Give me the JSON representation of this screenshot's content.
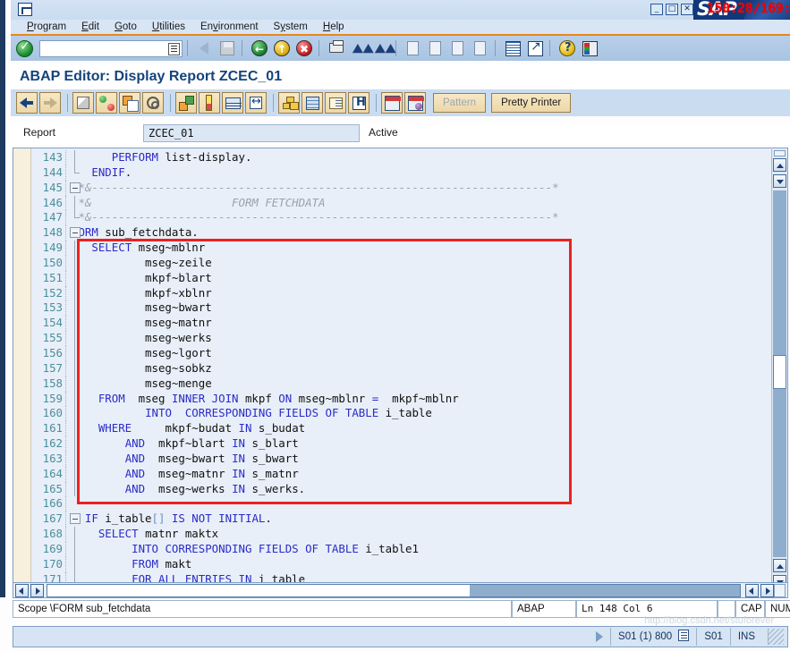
{
  "window": {
    "system_icon": "window-menu-icon",
    "minimize_label": "_",
    "maximize_label": "□",
    "close_label": "✕",
    "brand": "SAP",
    "timer_overlay": "150:28/169:"
  },
  "menubar": {
    "items": [
      {
        "label": "Program"
      },
      {
        "label": "Edit"
      },
      {
        "label": "Goto"
      },
      {
        "label": "Utilities"
      },
      {
        "label": "Environment"
      },
      {
        "label": "System"
      },
      {
        "label": "Help"
      }
    ]
  },
  "main_toolbar": {
    "ok_button": "enter-ok-icon",
    "command_field_value": "",
    "command_field_placeholder": "",
    "icons": [
      "back-arrow-icon",
      "save-icon",
      "back-green-icon",
      "exit-yellow-icon",
      "cancel-red-icon",
      "print-icon",
      "find-icon",
      "find-next-icon",
      "first-page-icon",
      "previous-page-icon",
      "next-page-icon",
      "last-page-icon",
      "new-session-icon",
      "create-shortcut-icon",
      "help-icon",
      "layout-menu-icon"
    ]
  },
  "screen": {
    "title": "ABAP Editor: Display Report ZCEC_01"
  },
  "app_toolbar": {
    "icons": [
      "back-display-icon",
      "forward-display-icon",
      "display-change-icon",
      "check-syntax-icon",
      "copy-object-icon",
      "activate-spiral-icon",
      "object-navigator-icon",
      "check-icon",
      "activate-icon",
      "where-used-icon",
      "structure-tree-icon",
      "stack-icon",
      "list-icon",
      "info-icon",
      "debug-icon",
      "debug-user-icon"
    ],
    "pattern_label": "Pattern",
    "pattern_enabled": false,
    "pretty_printer_label": "Pretty Printer",
    "pretty_printer_enabled": true
  },
  "report_row": {
    "label": "Report",
    "value": "ZCEC_01",
    "status": "Active"
  },
  "code": {
    "first_line_number": 143,
    "lines": [
      {
        "num": "143",
        "fold": "vline",
        "tokens": [
          {
            "t": "      ",
            "c": "id"
          },
          {
            "t": "PERFORM",
            "c": "kw"
          },
          {
            "t": " ",
            "c": "id"
          },
          {
            "t": "list-display",
            "c": "id"
          },
          {
            "t": ".",
            "c": "id"
          }
        ]
      },
      {
        "num": "144",
        "fold": "corner",
        "tokens": [
          {
            "t": "   ",
            "c": "id"
          },
          {
            "t": "ENDIF",
            "c": "kw"
          },
          {
            "t": ".",
            "c": "id"
          }
        ]
      },
      {
        "num": "145",
        "fold": "box",
        "tokens": [
          {
            "t": " *&---------------------------------------------------------------------*",
            "c": "cmt"
          }
        ]
      },
      {
        "num": "146",
        "fold": "vline",
        "tokens": [
          {
            "t": " *&                     FORM FETCHDATA",
            "c": "cmt"
          }
        ]
      },
      {
        "num": "147",
        "fold": "corner",
        "tokens": [
          {
            "t": " *&---------------------------------------------------------------------*",
            "c": "cmt"
          }
        ]
      },
      {
        "num": "148",
        "fold": "box",
        "tokens": [
          {
            "t": "FORM",
            "c": "kw"
          },
          {
            "t": " sub_fetchdata.",
            "c": "id"
          }
        ]
      },
      {
        "num": "149",
        "fold": "vline",
        "tokens": [
          {
            "t": "   ",
            "c": "id"
          },
          {
            "t": "SELECT",
            "c": "kw"
          },
          {
            "t": " mseg~mblnr",
            "c": "id"
          }
        ]
      },
      {
        "num": "150",
        "fold": "vline",
        "tokens": [
          {
            "t": "           mseg~zeile",
            "c": "id"
          }
        ]
      },
      {
        "num": "151",
        "fold": "vline",
        "tokens": [
          {
            "t": "           mkpf~blart",
            "c": "id"
          }
        ]
      },
      {
        "num": "152",
        "fold": "vline",
        "tokens": [
          {
            "t": "           mkpf~xblnr",
            "c": "id"
          }
        ]
      },
      {
        "num": "153",
        "fold": "vline",
        "tokens": [
          {
            "t": "           mseg~bwart",
            "c": "id"
          }
        ]
      },
      {
        "num": "154",
        "fold": "vline",
        "tokens": [
          {
            "t": "           mseg~matnr",
            "c": "id"
          }
        ]
      },
      {
        "num": "155",
        "fold": "vline",
        "tokens": [
          {
            "t": "           mseg~werks",
            "c": "id"
          }
        ]
      },
      {
        "num": "156",
        "fold": "vline",
        "tokens": [
          {
            "t": "           mseg~lgort",
            "c": "id"
          }
        ]
      },
      {
        "num": "157",
        "fold": "vline",
        "tokens": [
          {
            "t": "           mseg~sobkz",
            "c": "id"
          }
        ]
      },
      {
        "num": "158",
        "fold": "vline",
        "tokens": [
          {
            "t": "           mseg~menge",
            "c": "id"
          }
        ]
      },
      {
        "num": "159",
        "fold": "vline",
        "tokens": [
          {
            "t": "    ",
            "c": "id"
          },
          {
            "t": "FROM",
            "c": "kw"
          },
          {
            "t": "  mseg ",
            "c": "id"
          },
          {
            "t": "INNER JOIN",
            "c": "kw"
          },
          {
            "t": " mkpf ",
            "c": "id"
          },
          {
            "t": "ON",
            "c": "kw"
          },
          {
            "t": " mseg~mblnr ",
            "c": "id"
          },
          {
            "t": "=",
            "c": "kw"
          },
          {
            "t": "  mkpf~mblnr",
            "c": "id"
          }
        ]
      },
      {
        "num": "160",
        "fold": "vline",
        "tokens": [
          {
            "t": "           ",
            "c": "id"
          },
          {
            "t": "INTO",
            "c": "kw"
          },
          {
            "t": "  ",
            "c": "id"
          },
          {
            "t": "CORRESPONDING FIELDS OF TABLE",
            "c": "kw"
          },
          {
            "t": " i_table",
            "c": "id"
          }
        ]
      },
      {
        "num": "161",
        "fold": "vline",
        "tokens": [
          {
            "t": "    ",
            "c": "id"
          },
          {
            "t": "WHERE",
            "c": "kw"
          },
          {
            "t": "     mkpf~budat ",
            "c": "id"
          },
          {
            "t": "IN",
            "c": "kw"
          },
          {
            "t": " s_budat",
            "c": "id"
          }
        ]
      },
      {
        "num": "162",
        "fold": "vline",
        "tokens": [
          {
            "t": "        ",
            "c": "id"
          },
          {
            "t": "AND",
            "c": "kw"
          },
          {
            "t": "  mkpf~blart ",
            "c": "id"
          },
          {
            "t": "IN",
            "c": "kw"
          },
          {
            "t": " s_blart",
            "c": "id"
          }
        ]
      },
      {
        "num": "163",
        "fold": "vline",
        "tokens": [
          {
            "t": "        ",
            "c": "id"
          },
          {
            "t": "AND",
            "c": "kw"
          },
          {
            "t": "  mseg~bwart ",
            "c": "id"
          },
          {
            "t": "IN",
            "c": "kw"
          },
          {
            "t": " s_bwart",
            "c": "id"
          }
        ]
      },
      {
        "num": "164",
        "fold": "vline",
        "tokens": [
          {
            "t": "        ",
            "c": "id"
          },
          {
            "t": "AND",
            "c": "kw"
          },
          {
            "t": "  mseg~matnr ",
            "c": "id"
          },
          {
            "t": "IN",
            "c": "kw"
          },
          {
            "t": " s_matnr",
            "c": "id"
          }
        ]
      },
      {
        "num": "165",
        "fold": "vline",
        "tokens": [
          {
            "t": "        ",
            "c": "id"
          },
          {
            "t": "AND",
            "c": "kw"
          },
          {
            "t": "  mseg~werks ",
            "c": "id"
          },
          {
            "t": "IN",
            "c": "kw"
          },
          {
            "t": " s_werks.",
            "c": "id"
          }
        ]
      },
      {
        "num": "166",
        "fold": "none",
        "tokens": [
          {
            "t": "",
            "c": "id"
          }
        ]
      },
      {
        "num": "167",
        "fold": "box",
        "tokens": [
          {
            "t": "  ",
            "c": "id"
          },
          {
            "t": "IF",
            "c": "kw"
          },
          {
            "t": " i_table",
            "c": "id"
          },
          {
            "t": "[]",
            "c": "br"
          },
          {
            "t": " ",
            "c": "id"
          },
          {
            "t": "IS NOT INITIAL",
            "c": "kw"
          },
          {
            "t": ".",
            "c": "id"
          }
        ]
      },
      {
        "num": "168",
        "fold": "vline",
        "tokens": [
          {
            "t": "    ",
            "c": "id"
          },
          {
            "t": "SELECT",
            "c": "kw"
          },
          {
            "t": " matnr maktx",
            "c": "id"
          }
        ]
      },
      {
        "num": "169",
        "fold": "vline",
        "tokens": [
          {
            "t": "         ",
            "c": "id"
          },
          {
            "t": "INTO CORRESPONDING FIELDS OF TABLE",
            "c": "kw"
          },
          {
            "t": " i_table1",
            "c": "id"
          }
        ]
      },
      {
        "num": "170",
        "fold": "vline",
        "tokens": [
          {
            "t": "         ",
            "c": "id"
          },
          {
            "t": "FROM",
            "c": "kw"
          },
          {
            "t": " makt",
            "c": "id"
          }
        ]
      },
      {
        "num": "171",
        "fold": "vline",
        "tokens": [
          {
            "t": "         ",
            "c": "id"
          },
          {
            "t": "FOR ALL ENTRIES IN",
            "c": "kw"
          },
          {
            "t": " i_table",
            "c": "id"
          }
        ]
      }
    ],
    "annotation": {
      "type": "red-rectangle",
      "color": "#ee2020"
    }
  },
  "editor_status": {
    "scope": "Scope \\FORM sub_fetchdata",
    "language": "ABAP",
    "position": "Ln 148 Col  6",
    "gap": "",
    "cap": "CAP",
    "num": "NUM",
    "icon": "insert-mode-icon"
  },
  "system_status": {
    "server": "S01 (1) 800",
    "system_icon": "server-session-icon",
    "instance": "S01",
    "insert_mode": "INS",
    "resize_grip": "resize-grip-icon",
    "watermark": "http://blog.csdn.net/stuforever"
  }
}
